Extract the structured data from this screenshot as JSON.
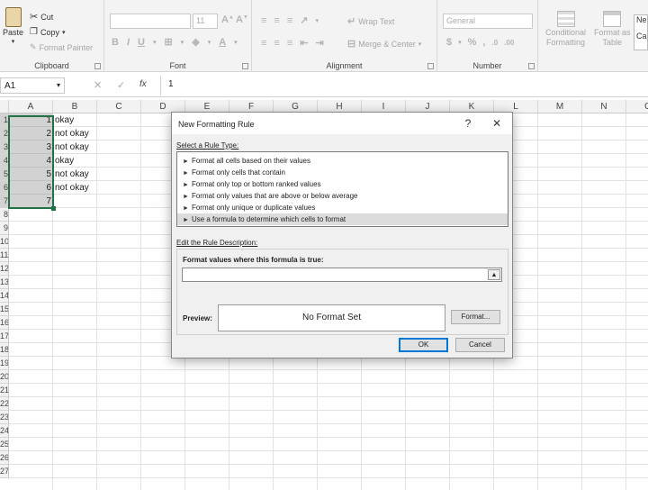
{
  "ribbon": {
    "clipboard": {
      "label": "Clipboard",
      "paste": "Paste",
      "cut": "Cut",
      "copy": "Copy",
      "format_painter": "Format Painter"
    },
    "font": {
      "label": "Font",
      "font_size": "11"
    },
    "alignment": {
      "label": "Alignment",
      "wrap_text": "Wrap Text",
      "merge_center": "Merge & Center"
    },
    "number": {
      "label": "Number",
      "format": "General"
    },
    "styles": {
      "conditional_line1": "Conditional",
      "conditional_line2": "Formatting",
      "format_as_line1": "Format as",
      "format_as_line2": "Table",
      "cell_styles_line1": "Ne",
      "cell_styles_line2": "Ca"
    }
  },
  "formula_bar": {
    "name_box": "A1",
    "fx": "fx",
    "content": "1"
  },
  "columns": [
    "A",
    "B",
    "C",
    "D",
    "E",
    "F",
    "G",
    "H",
    "I",
    "J",
    "K",
    "L",
    "M",
    "N",
    "O"
  ],
  "rows": [
    "1",
    "2",
    "3",
    "4",
    "5",
    "6",
    "7",
    "8",
    "9",
    "10",
    "11",
    "12",
    "13",
    "14",
    "15",
    "16",
    "17",
    "18",
    "19",
    "20",
    "21",
    "22",
    "23",
    "24",
    "25",
    "26",
    "27"
  ],
  "data_rows": [
    {
      "a": "1",
      "b": "okay"
    },
    {
      "a": "2",
      "b": "not okay"
    },
    {
      "a": "3",
      "b": "not okay"
    },
    {
      "a": "4",
      "b": "okay"
    },
    {
      "a": "5",
      "b": "not okay"
    },
    {
      "a": "6",
      "b": "not okay"
    },
    {
      "a": "7",
      "b": ""
    }
  ],
  "dialog": {
    "title": "New Formatting Rule",
    "help": "?",
    "close": "✕",
    "select_rule_type": "Select a Rule Type:",
    "rule_types": [
      "Format all cells based on their values",
      "Format only cells that contain",
      "Format only top or bottom ranked values",
      "Format only values that are above or below average",
      "Format only unique or duplicate values",
      "Use a formula to determine which cells to format"
    ],
    "selected_index": 5,
    "edit_description": "Edit the Rule Description:",
    "formula_label": "Format values where this formula is true:",
    "formula_value": "",
    "preview_label": "Preview:",
    "preview_text": "No Format Set",
    "format_button": "Format...",
    "ok": "OK",
    "cancel": "Cancel"
  }
}
